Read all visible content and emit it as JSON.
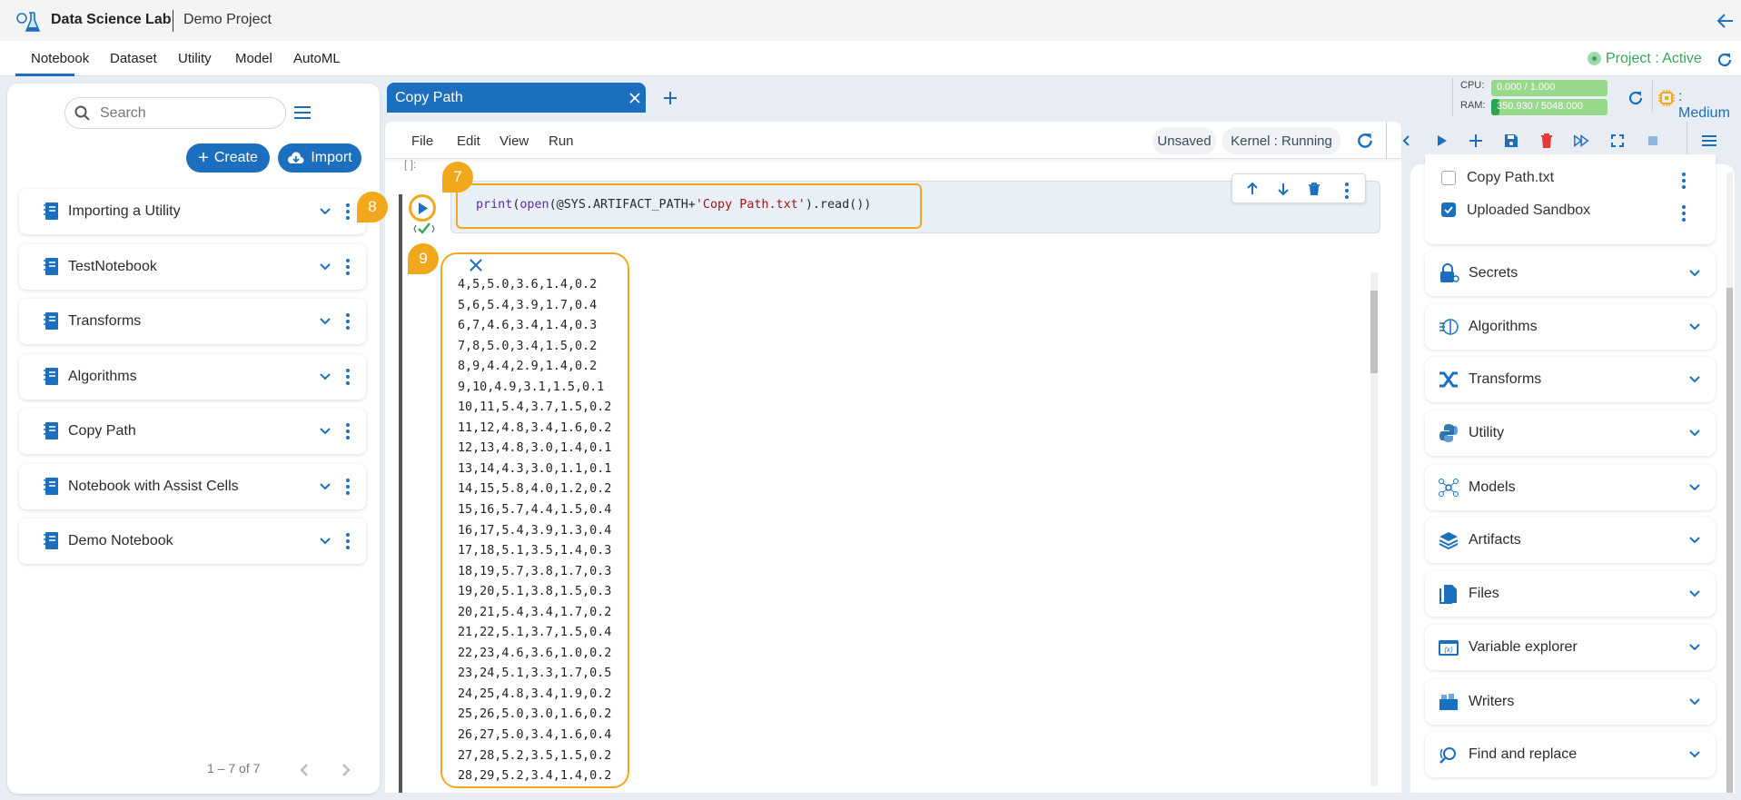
{
  "header": {
    "app_title": "Data Science Lab",
    "project_name": "Demo Project"
  },
  "nav": {
    "tabs": [
      "Notebook",
      "Dataset",
      "Utility",
      "Model",
      "AutoML"
    ],
    "active": "Notebook",
    "status": "Project : Active"
  },
  "sidebar": {
    "search_placeholder": "Search",
    "create_label": "Create",
    "import_label": "Import",
    "notebooks": [
      "Importing a Utility",
      "TestNotebook",
      "Transforms",
      "Algorithms",
      "Copy Path",
      "Notebook with Assist Cells",
      "Demo Notebook"
    ],
    "pagination": "1 – 7 of 7"
  },
  "tabs": {
    "open": [
      "Copy Path"
    ]
  },
  "resources": {
    "cpu_label": "CPU:",
    "cpu_value": "0.000 / 1.000",
    "cpu_fraction": 0.0,
    "ram_label": "RAM:",
    "ram_value": "350.930 / 5048.000",
    "ram_fraction": 0.0695,
    "size_label": ": Medium"
  },
  "menu": {
    "items": [
      "File",
      "Edit",
      "View",
      "Run"
    ],
    "unsaved": "Unsaved",
    "kernel": "Kernel : Running"
  },
  "cell": {
    "prompt": "[ ]:",
    "code_fn": "print",
    "code_open": "open",
    "code_mid": "(@SYS.ARTIFACT_PATH+",
    "code_str": "'Copy Path.txt'",
    "code_end": ").read())",
    "output": [
      "4,5,5.0,3.6,1.4,0.2",
      "5,6,5.4,3.9,1.7,0.4",
      "6,7,4.6,3.4,1.4,0.3",
      "7,8,5.0,3.4,1.5,0.2",
      "8,9,4.4,2.9,1.4,0.2",
      "9,10,4.9,3.1,1.5,0.1",
      "10,11,5.4,3.7,1.5,0.2",
      "11,12,4.8,3.4,1.6,0.2",
      "12,13,4.8,3.0,1.4,0.1",
      "13,14,4.3,3.0,1.1,0.1",
      "14,15,5.8,4.0,1.2,0.2",
      "15,16,5.7,4.4,1.5,0.4",
      "16,17,5.4,3.9,1.3,0.4",
      "17,18,5.1,3.5,1.4,0.3",
      "18,19,5.7,3.8,1.7,0.3",
      "19,20,5.1,3.8,1.5,0.3",
      "20,21,5.4,3.4,1.7,0.2",
      "21,22,5.1,3.7,1.5,0.4",
      "22,23,4.6,3.6,1.0,0.2",
      "23,24,5.1,3.3,1.7,0.5",
      "24,25,4.8,3.4,1.9,0.2",
      "25,26,5.0,3.0,1.6,0.2",
      "26,27,5.0,3.4,1.6,0.4",
      "27,28,5.2,3.5,1.5,0.2",
      "28,29,5.2,3.4,1.4,0.2"
    ]
  },
  "callouts": [
    "7",
    "8",
    "9"
  ],
  "right_panel": {
    "artifacts": [
      {
        "name": "Copy Path.txt",
        "checked": false
      },
      {
        "name": "Uploaded Sandbox",
        "checked": true
      }
    ],
    "sections": [
      "Secrets",
      "Algorithms",
      "Transforms",
      "Utility",
      "Models",
      "Artifacts",
      "Files",
      "Variable explorer",
      "Writers",
      "Find and replace"
    ]
  },
  "colors": {
    "accent": "#1b6fbe",
    "callout": "#f2a81d",
    "active": "#3aa655",
    "delete": "#e53935"
  }
}
